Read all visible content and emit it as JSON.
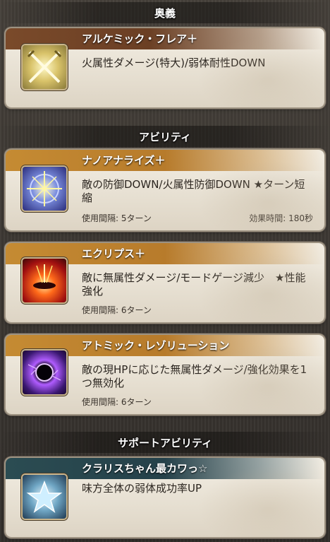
{
  "sections": {
    "ougi": "奥義",
    "abilities": "アビリティ",
    "support": "サポートアビリティ"
  },
  "ougi_card": {
    "title": "アルケミック・フレア＋",
    "description": "火属性ダメージ(特大)/弱体耐性DOWN",
    "icon": "crossed-swords-icon"
  },
  "abilities": [
    {
      "title": "ナノアナライズ＋",
      "description": "敵の防御DOWN/火属性防御DOWN ★ターン短縮",
      "cooldown": "使用間隔: 5ターン",
      "duration": "効果時間: 180秒",
      "icon": "analyze-icon"
    },
    {
      "title": "エクリプス＋",
      "description": "敵に無属性ダメージ/モードゲージ減少　★性能強化",
      "cooldown": "使用間隔: 6ターン",
      "icon": "eclipse-icon"
    },
    {
      "title": "アトミック・レゾリューション",
      "description": "敵の現HPに応じた無属性ダメージ/強化効果を1つ無効化",
      "cooldown": "使用間隔: 6ターン",
      "icon": "black-hole-icon"
    }
  ],
  "support_card": {
    "title": "クラリスちゃん最カワっ☆",
    "description": "味方全体の弱体成功率UP",
    "icon": "star-icon"
  }
}
